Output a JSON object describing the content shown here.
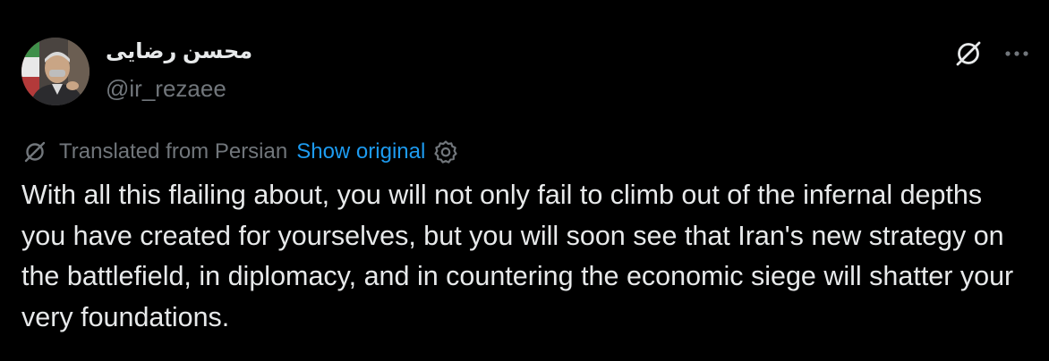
{
  "author": {
    "display_name": "محسن رضایی",
    "handle": "@ir_rezaee",
    "avatar_icon": "profile-photo"
  },
  "header_actions": {
    "grok_icon": "grok-slash-icon",
    "more_icon": "ellipsis-icon"
  },
  "translation": {
    "label": "Translated from Persian",
    "show_original": "Show original",
    "settings_icon": "gear-icon",
    "link_color": "#1d9bf0"
  },
  "tweet": {
    "text": "With all this flailing about, you will not only fail to climb out of the infernal depths you have created for yourselves, but you will soon see that Iran's new strategy on the battlefield, in diplomacy, and in countering the economic siege will shatter your very foundations."
  },
  "colors": {
    "background": "#000000",
    "primary_text": "#e7e9ea",
    "secondary_text": "#71767b"
  }
}
